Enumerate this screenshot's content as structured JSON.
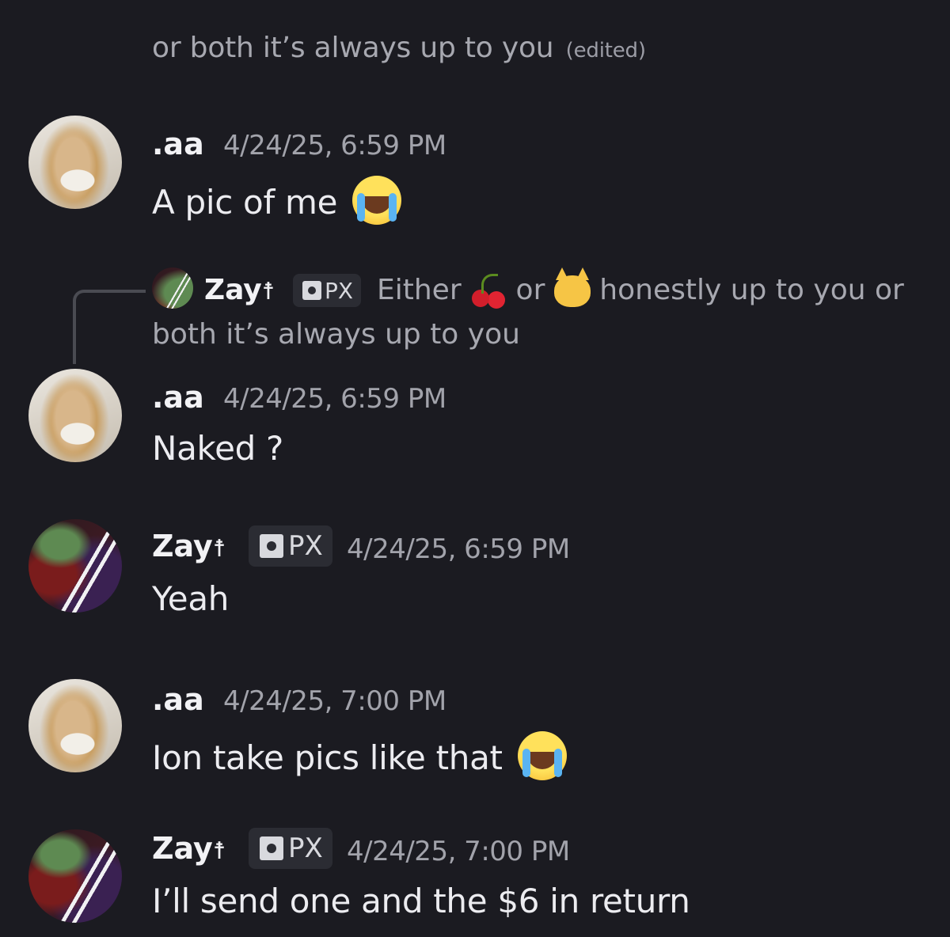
{
  "continuation": {
    "text": "or both it’s always up to you",
    "edited_label": "(edited)"
  },
  "messages": [
    {
      "author": ".aa",
      "timestamp": "4/24/25, 6:59 PM",
      "text": "A pic of me",
      "emoji": "loudly-crying-face"
    },
    {
      "reply": {
        "author": "Zay",
        "cross": "☨",
        "tag": "PX",
        "text_part1": "Either",
        "emoji1": "cherries",
        "text_part2": "or",
        "emoji2": "cat-face",
        "text_part3": "honestly up to you  or",
        "text_line2": "both it’s always up to you"
      },
      "author": ".aa",
      "timestamp": "4/24/25, 6:59 PM",
      "text": "Naked ?"
    },
    {
      "author": "Zay",
      "cross": "☨",
      "tag": "PX",
      "timestamp": "4/24/25, 6:59 PM",
      "text": "Yeah"
    },
    {
      "author": ".aa",
      "timestamp": "4/24/25, 7:00 PM",
      "text": "Ion take pics like that",
      "emoji": "loudly-crying-face"
    },
    {
      "author": "Zay",
      "cross": "☨",
      "tag": "PX",
      "timestamp": "4/24/25, 7:00 PM",
      "text": "I’ll send one and the $6 in return"
    }
  ],
  "colors": {
    "background": "#1b1b21",
    "text": "#ececf0",
    "muted": "#a2a3ab",
    "tag_bg": "#2b2c33"
  }
}
